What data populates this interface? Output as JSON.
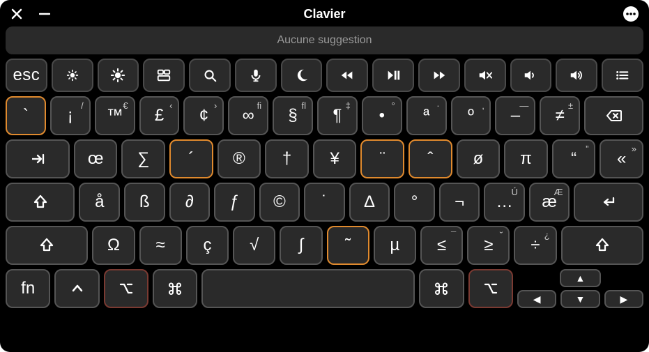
{
  "window": {
    "title": "Clavier"
  },
  "suggestion": {
    "text": "Aucune suggestion"
  },
  "fn_row": [
    {
      "name": "esc-key",
      "label": "esc",
      "type": "text"
    },
    {
      "name": "brightness-down-key",
      "type": "icon",
      "icon": "brightness-low"
    },
    {
      "name": "brightness-up-key",
      "type": "icon",
      "icon": "brightness-high"
    },
    {
      "name": "mission-control-key",
      "type": "icon",
      "icon": "mission-control"
    },
    {
      "name": "search-key",
      "type": "icon",
      "icon": "search"
    },
    {
      "name": "dictation-key",
      "type": "icon",
      "icon": "mic"
    },
    {
      "name": "dnd-key",
      "type": "icon",
      "icon": "moon"
    },
    {
      "name": "rewind-key",
      "type": "icon",
      "icon": "rewind"
    },
    {
      "name": "playpause-key",
      "type": "icon",
      "icon": "playpause"
    },
    {
      "name": "forward-key",
      "type": "icon",
      "icon": "forward"
    },
    {
      "name": "mute-key",
      "type": "icon",
      "icon": "mute"
    },
    {
      "name": "volume-down-key",
      "type": "icon",
      "icon": "vol-low"
    },
    {
      "name": "volume-up-key",
      "type": "icon",
      "icon": "vol-high"
    },
    {
      "name": "list-key",
      "type": "icon",
      "icon": "list"
    }
  ],
  "row1": [
    {
      "name": "backtick-key",
      "main": "`",
      "sup": "",
      "hl": "orange"
    },
    {
      "name": "key-1-alt",
      "main": "¡",
      "sup": "/"
    },
    {
      "name": "key-2-alt",
      "main": "™",
      "sup": "€"
    },
    {
      "name": "key-3-alt",
      "main": "£",
      "sup": "‹"
    },
    {
      "name": "key-4-alt",
      "main": "¢",
      "sup": "›"
    },
    {
      "name": "key-5-alt",
      "main": "∞",
      "sup": "fi"
    },
    {
      "name": "key-6-alt",
      "main": "§",
      "sup": "fl"
    },
    {
      "name": "key-7-alt",
      "main": "¶",
      "sup": "‡"
    },
    {
      "name": "key-8-alt",
      "main": "•",
      "sup": "°"
    },
    {
      "name": "key-9-alt",
      "main": "ª",
      "sup": "·"
    },
    {
      "name": "key-0-alt",
      "main": "º",
      "sup": "‚"
    },
    {
      "name": "key-minus-alt",
      "main": "–",
      "sup": "—"
    },
    {
      "name": "key-equal-alt",
      "main": "≠",
      "sup": "±"
    },
    {
      "name": "backspace-key",
      "icon": "backspace",
      "wide": "wide15"
    }
  ],
  "row2": [
    {
      "name": "tab-key",
      "icon": "tab",
      "wide": "wide15"
    },
    {
      "name": "key-q-alt",
      "main": "œ",
      "sup": ""
    },
    {
      "name": "key-w-alt",
      "main": "∑",
      "sup": ""
    },
    {
      "name": "key-e-alt",
      "main": "´",
      "sup": "",
      "hl": "orange"
    },
    {
      "name": "key-r-alt",
      "main": "®",
      "sup": ""
    },
    {
      "name": "key-t-alt",
      "main": "†",
      "sup": ""
    },
    {
      "name": "key-y-alt",
      "main": "¥",
      "sup": ""
    },
    {
      "name": "key-u-alt",
      "main": "¨",
      "sup": "",
      "hl": "orange"
    },
    {
      "name": "key-i-alt",
      "main": "ˆ",
      "sup": "",
      "hl": "orange"
    },
    {
      "name": "key-o-alt",
      "main": "ø",
      "sup": ""
    },
    {
      "name": "key-p-alt",
      "main": "π",
      "sup": ""
    },
    {
      "name": "key-lbracket-alt",
      "main": "“",
      "sup": "”"
    },
    {
      "name": "key-rbracket-alt",
      "main": "«",
      "sup": "»"
    }
  ],
  "row3": [
    {
      "name": "capslock-key",
      "icon": "shift-outline",
      "wide": "wide175"
    },
    {
      "name": "key-a-alt",
      "main": "å",
      "sup": ""
    },
    {
      "name": "key-s-alt",
      "main": "ß",
      "sup": ""
    },
    {
      "name": "key-d-alt",
      "main": "∂",
      "sup": ""
    },
    {
      "name": "key-f-alt",
      "main": "ƒ",
      "sup": ""
    },
    {
      "name": "key-g-alt",
      "main": "©",
      "sup": ""
    },
    {
      "name": "key-h-alt",
      "main": "˙",
      "sup": ""
    },
    {
      "name": "key-j-alt",
      "main": "∆",
      "sup": ""
    },
    {
      "name": "key-k-alt",
      "main": "°",
      "sup": ""
    },
    {
      "name": "key-l-alt",
      "main": "¬",
      "sup": ""
    },
    {
      "name": "key-semicolon-alt",
      "main": "…",
      "sup": "Ú"
    },
    {
      "name": "key-quote-alt",
      "main": "æ",
      "sup": "Æ"
    },
    {
      "name": "return-key",
      "icon": "return",
      "wide": "wide175"
    }
  ],
  "row4": [
    {
      "name": "shift-left-key",
      "icon": "shift-outline",
      "wide": "wide2"
    },
    {
      "name": "key-z-alt",
      "main": "Ω",
      "sup": ""
    },
    {
      "name": "key-x-alt",
      "main": "≈",
      "sup": ""
    },
    {
      "name": "key-c-alt",
      "main": "ç",
      "sup": ""
    },
    {
      "name": "key-v-alt",
      "main": "√",
      "sup": ""
    },
    {
      "name": "key-b-alt",
      "main": "∫",
      "sup": ""
    },
    {
      "name": "key-n-alt",
      "main": "˜",
      "sup": "",
      "hl": "orange"
    },
    {
      "name": "key-m-alt",
      "main": "µ",
      "sup": ""
    },
    {
      "name": "key-comma-alt",
      "main": "≤",
      "sup": "¯"
    },
    {
      "name": "key-period-alt",
      "main": "≥",
      "sup": "˘"
    },
    {
      "name": "key-slash-alt",
      "main": "÷",
      "sup": "¿"
    },
    {
      "name": "shift-right-key",
      "icon": "shift-outline",
      "wide": "wide2"
    }
  ],
  "row5": [
    {
      "name": "fn-key",
      "main": "fn",
      "wide": ""
    },
    {
      "name": "control-key",
      "icon": "control",
      "wide": ""
    },
    {
      "name": "option-left-key",
      "icon": "option",
      "wide": "",
      "hl": "redish"
    },
    {
      "name": "command-left-key",
      "icon": "command",
      "wide": ""
    },
    {
      "name": "space-key",
      "main": "",
      "wide": "space"
    },
    {
      "name": "command-right-key",
      "icon": "command",
      "wide": ""
    },
    {
      "name": "option-right-key",
      "icon": "option",
      "wide": "",
      "hl": "redish"
    }
  ],
  "arrows": {
    "up": "▲",
    "left": "◀",
    "down": "▼",
    "right": "▶"
  }
}
